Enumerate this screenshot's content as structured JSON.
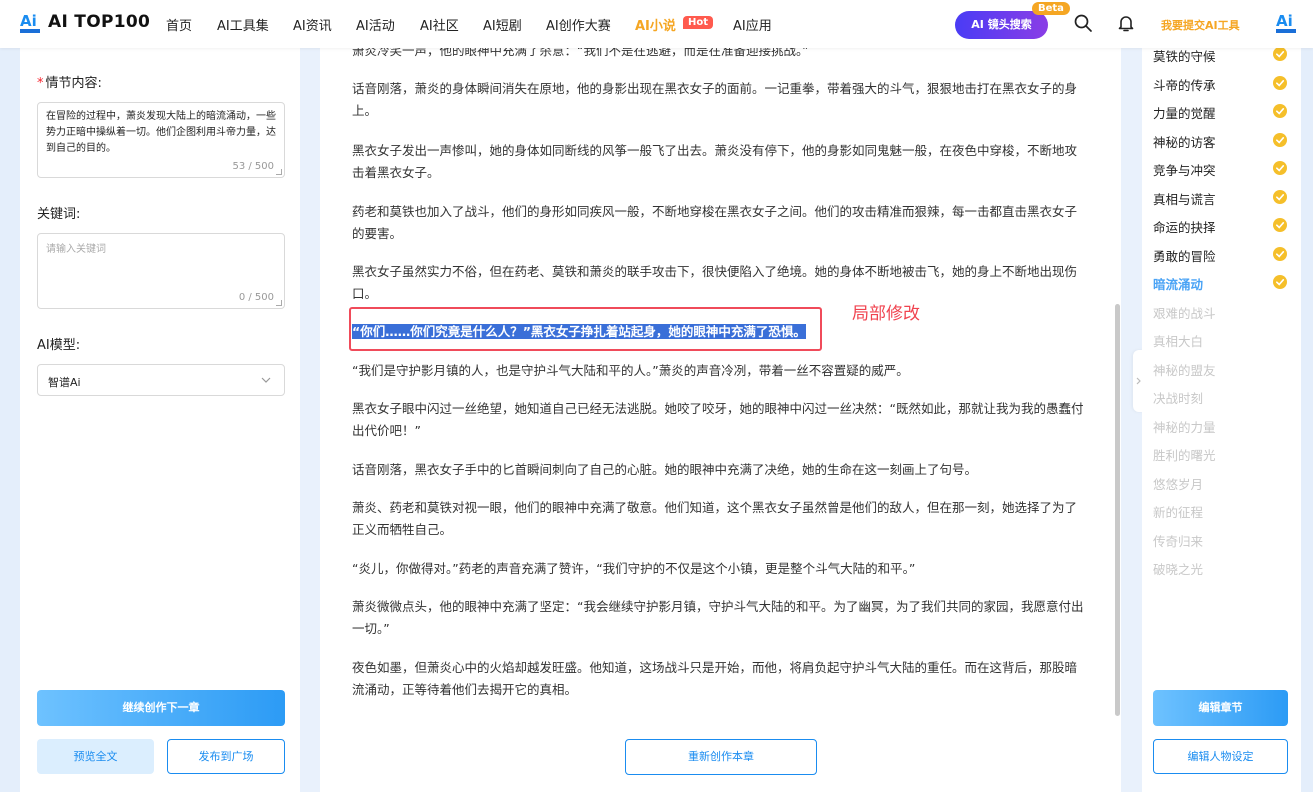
{
  "header": {
    "logo_text": "AI TOP100",
    "nav": [
      "首页",
      "AI工具集",
      "AI资讯",
      "AI活动",
      "AI社区",
      "AI短剧",
      "AI创作大赛",
      "AI小说",
      "AI应用"
    ],
    "active_nav": "AI小说",
    "hot_badge": "Hot",
    "ai_search_label": "AI 镜头搜索",
    "beta_badge": "Beta",
    "submit_link": "我要提交AI工具",
    "brand_color": "#f5a623"
  },
  "left_panel": {
    "plot_label": "情节内容:",
    "plot_required_mark": "*",
    "plot_value": "在冒险的过程中，萧炎发现大陆上的暗流涌动，一些势力正暗中操纵着一切。他们企图利用斗帝力量，达到自己的目的。",
    "plot_count": "53 / 500",
    "keywords_label": "关键词:",
    "keywords_placeholder": "请输入关键词",
    "keywords_count": "0 / 500",
    "model_label": "AI模型:",
    "model_value": "智谱Ai",
    "continue_btn": "继续创作下一章",
    "preview_btn": "预览全文",
    "publish_btn": "发布到广场"
  },
  "content": {
    "paragraphs": [
      "萧炎冷笑一声，他的眼神中充满了杀意：“我们不是在逃避，而是在准备迎接挑战。”",
      "话音刚落，萧炎的身体瞬间消失在原地，他的身影出现在黑衣女子的面前。一记重拳，带着强大的斗气，狠狠地击打在黑衣女子的身上。",
      "黑衣女子发出一声惨叫，她的身体如同断线的风筝一般飞了出去。萧炎没有停下，他的身影如同鬼魅一般，在夜色中穿梭，不断地攻击着黑衣女子。",
      "药老和莫铁也加入了战斗，他们的身形如同疾风一般，不断地穿梭在黑衣女子之间。他们的攻击精准而狠辣，每一击都直击黑衣女子的要害。",
      "黑衣女子虽然实力不俗，但在药老、莫铁和萧炎的联手攻击下，很快便陷入了绝境。她的身体不断地被击飞，她的身上不断地出现伤口。",
      "“你们……你们究竟是什么人？”黑衣女子挣扎着站起身，她的眼神中充满了恐惧。",
      "“我们是守护影月镇的人，也是守护斗气大陆和平的人。”萧炎的声音冷冽，带着一丝不容置疑的威严。",
      "黑衣女子眼中闪过一丝绝望，她知道自己已经无法逃脱。她咬了咬牙，她的眼神中闪过一丝决然：“既然如此，那就让我为我的愚蠢付出代价吧！”",
      "话音刚落，黑衣女子手中的匕首瞬间刺向了自己的心脏。她的眼神中充满了决绝，她的生命在这一刻画上了句号。",
      "萧炎、药老和莫铁对视一眼，他们的眼神中充满了敬意。他们知道，这个黑衣女子虽然曾是他们的敌人，但在那一刻，她选择了为了正义而牺牲自己。",
      "“炎儿，你做得对。”药老的声音充满了赞许，“我们守护的不仅是这个小镇，更是整个斗气大陆的和平。”",
      "萧炎微微点头，他的眼神中充满了坚定：“我会继续守护影月镇，守护斗气大陆的和平。为了幽冥，为了我们共同的家园，我愿意付出一切。”",
      "夜色如墨，但萧炎心中的火焰却越发旺盛。他知道，这场战斗只是开始，而他，将肩负起守护斗气大陆的重任。而在这背后，那股暗流涌动，正等待着他们去揭开它的真相。"
    ],
    "highlighted_index": 5,
    "annotation": "局部修改",
    "rewrite_btn": "重新创作本章"
  },
  "chapters": {
    "items": [
      {
        "title": "莫铁的守候",
        "status": "done"
      },
      {
        "title": "斗帝的传承",
        "status": "done"
      },
      {
        "title": "力量的觉醒",
        "status": "done"
      },
      {
        "title": "神秘的访客",
        "status": "done"
      },
      {
        "title": "竞争与冲突",
        "status": "done"
      },
      {
        "title": "真相与谎言",
        "status": "done"
      },
      {
        "title": "命运的抉择",
        "status": "done"
      },
      {
        "title": "勇敢的冒险",
        "status": "done"
      },
      {
        "title": "暗流涌动",
        "status": "current"
      },
      {
        "title": "艰难的战斗",
        "status": "todo"
      },
      {
        "title": "真相大白",
        "status": "todo"
      },
      {
        "title": "神秘的盟友",
        "status": "todo"
      },
      {
        "title": "决战时刻",
        "status": "todo"
      },
      {
        "title": "神秘的力量",
        "status": "todo"
      },
      {
        "title": "胜利的曙光",
        "status": "todo"
      },
      {
        "title": "悠悠岁月",
        "status": "todo"
      },
      {
        "title": "新的征程",
        "status": "todo"
      },
      {
        "title": "传奇归来",
        "status": "todo"
      },
      {
        "title": "破晓之光",
        "status": "todo"
      }
    ],
    "edit_chapter_btn": "编辑章节",
    "edit_characters_btn": "编辑人物设定",
    "check_color": "#f5bf2a"
  }
}
